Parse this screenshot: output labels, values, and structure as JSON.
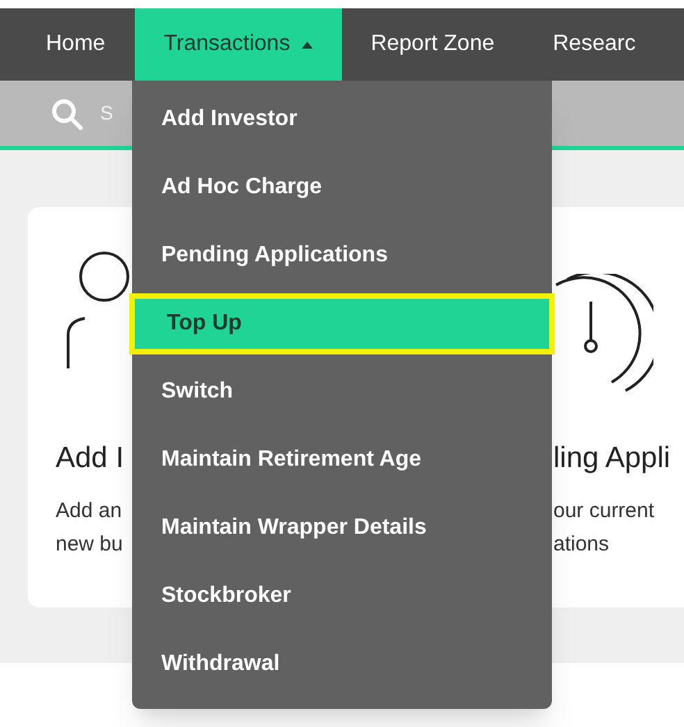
{
  "nav": {
    "tabs": [
      {
        "label": "Home",
        "selected": false,
        "caret": false
      },
      {
        "label": "Transactions",
        "selected": true,
        "caret": true
      },
      {
        "label": "Report Zone",
        "selected": false,
        "caret": false
      },
      {
        "label": "Researc",
        "selected": false,
        "caret": false
      }
    ]
  },
  "search": {
    "placeholder": "S"
  },
  "cards": [
    {
      "title": "Add I",
      "lines": [
        "Add an",
        "new bu"
      ]
    },
    {
      "title": "ling Appli",
      "lines": [
        "our current",
        "ations"
      ]
    }
  ],
  "dropdown": {
    "items": [
      {
        "label": "Add Investor",
        "selected": false
      },
      {
        "label": "Ad Hoc Charge",
        "selected": false
      },
      {
        "label": "Pending Applications",
        "selected": false
      },
      {
        "label": "Top Up",
        "selected": true
      },
      {
        "label": "Switch",
        "selected": false
      },
      {
        "label": "Maintain Retirement Age",
        "selected": false
      },
      {
        "label": "Maintain Wrapper Details",
        "selected": false
      },
      {
        "label": "Stockbroker",
        "selected": false
      },
      {
        "label": "Withdrawal",
        "selected": false
      }
    ]
  }
}
